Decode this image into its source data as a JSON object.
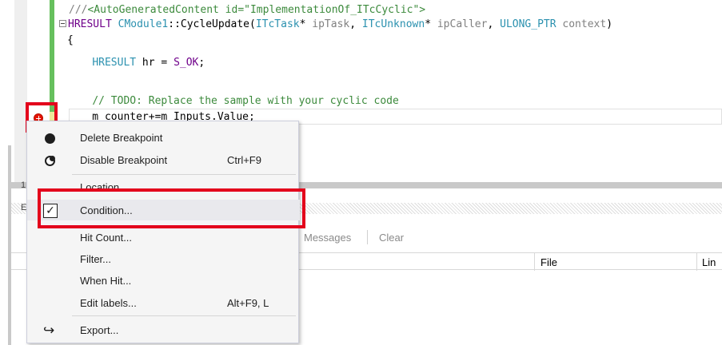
{
  "editor": {
    "lines": [
      {
        "parts": [
          {
            "t": "///",
            "c": "tok-gray"
          },
          {
            "t": "<AutoGeneratedContent id=\"ImplementationOf_ITcCyclic\">",
            "c": "tok-comment"
          }
        ]
      },
      {
        "parts": [
          {
            "t": "HRESULT ",
            "c": "tok-macro"
          },
          {
            "t": "CModule1",
            "c": "tok-type"
          },
          {
            "t": "::",
            "c": ""
          },
          {
            "t": "CycleUpdate",
            "c": ""
          },
          {
            "t": "(",
            "c": ""
          },
          {
            "t": "ITcTask",
            "c": "tok-type"
          },
          {
            "t": "* ",
            "c": ""
          },
          {
            "t": "ipTask",
            "c": "tok-gray"
          },
          {
            "t": ", ",
            "c": ""
          },
          {
            "t": "ITcUnknown",
            "c": "tok-type"
          },
          {
            "t": "* ",
            "c": ""
          },
          {
            "t": "ipCaller",
            "c": "tok-gray"
          },
          {
            "t": ", ",
            "c": ""
          },
          {
            "t": "ULONG_PTR",
            "c": "tok-type"
          },
          {
            "t": " ",
            "c": ""
          },
          {
            "t": "context",
            "c": "tok-gray"
          },
          {
            "t": ")",
            "c": ""
          }
        ]
      },
      {
        "parts": [
          {
            "t": "{",
            "c": ""
          }
        ]
      },
      {
        "parts": [
          {
            "t": "    ",
            "c": ""
          },
          {
            "t": "HRESULT",
            "c": "tok-type"
          },
          {
            "t": " hr = ",
            "c": ""
          },
          {
            "t": "S_OK",
            "c": "tok-macro"
          },
          {
            "t": ";",
            "c": ""
          }
        ]
      },
      {
        "parts": [
          {
            "t": "",
            "c": ""
          }
        ]
      },
      {
        "parts": [
          {
            "t": "    ",
            "c": ""
          },
          {
            "t": "// TODO: Replace the sample with your cyclic code",
            "c": "tok-comment"
          }
        ]
      },
      {
        "parts": [
          {
            "t": "    m_counter+=m_Inputs.Value;",
            "c": ""
          }
        ]
      }
    ]
  },
  "lower_panel": {
    "tab1": "1",
    "tab2": "E",
    "toolbar": {
      "messages": "Messages",
      "clear": "Clear"
    },
    "columns": {
      "file": "File",
      "line": "Lin"
    }
  },
  "context_menu": {
    "items": [
      {
        "id": "delete-breakpoint",
        "icon": "dot",
        "label": "Delete Breakpoint",
        "shortcut": ""
      },
      {
        "id": "disable-breakpoint",
        "icon": "disable",
        "label": "Disable Breakpoint",
        "shortcut": "Ctrl+F9"
      },
      {
        "id": "location",
        "icon": "",
        "label": "Location...",
        "shortcut": ""
      },
      {
        "id": "condition",
        "icon": "check",
        "label": "Condition...",
        "shortcut": ""
      },
      {
        "id": "hit-count",
        "icon": "",
        "label": "Hit Count...",
        "shortcut": ""
      },
      {
        "id": "filter",
        "icon": "",
        "label": "Filter...",
        "shortcut": ""
      },
      {
        "id": "when-hit",
        "icon": "",
        "label": "When Hit...",
        "shortcut": ""
      },
      {
        "id": "edit-labels",
        "icon": "",
        "label": "Edit labels...",
        "shortcut": "Alt+F9, L"
      },
      {
        "id": "export",
        "icon": "export",
        "label": "Export...",
        "shortcut": ""
      }
    ],
    "checkmark_glyph": "✓",
    "export_glyph": "↪"
  },
  "colors": {
    "highlight_red": "#e3001b",
    "breakpoint_red": "#e51400",
    "changed_green": "#66c05d",
    "menu_bg": "#f5f5f5"
  }
}
